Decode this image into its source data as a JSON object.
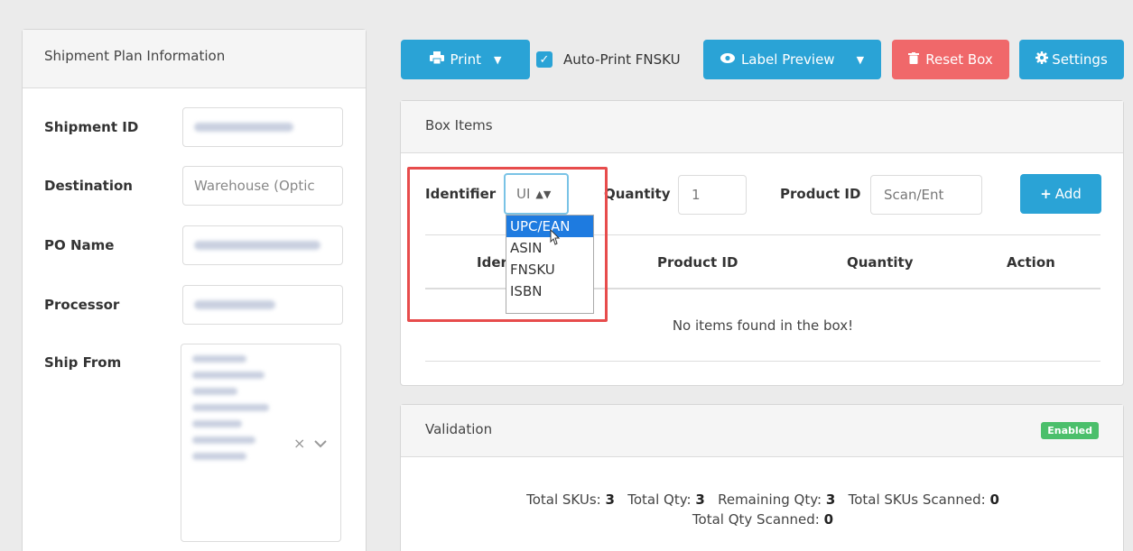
{
  "left_panel": {
    "title": "Shipment Plan Information",
    "fields": [
      {
        "label": "Shipment ID",
        "value": ""
      },
      {
        "label": "Destination",
        "value": "Warehouse (Optic"
      },
      {
        "label": "PO Name",
        "value": ""
      },
      {
        "label": "Processor",
        "value": ""
      },
      {
        "label": "Ship From",
        "value": ""
      }
    ],
    "clear_glyph": "×",
    "chevron_glyph": "⌄"
  },
  "toolbar": {
    "print_label": "Print",
    "auto_print_label": "Auto-Print FNSKU",
    "label_preview_label": "Label Preview",
    "reset_box_label": "Reset Box",
    "settings_label": "Settings"
  },
  "box_items": {
    "title": "Box Items",
    "identifier_label": "Identifier",
    "identifier_selected": "UI",
    "identifier_options": [
      "UPC/EAN",
      "ASIN",
      "FNSKU",
      "ISBN"
    ],
    "quantity_label": "Quantity",
    "quantity_value": "1",
    "product_id_label": "Product ID",
    "product_id_placeholder": "Scan/Ent",
    "add_label": "Add",
    "columns": [
      "Ider",
      "Product ID",
      "Quantity",
      "Action"
    ],
    "empty_message": "No items found in the box!"
  },
  "validation": {
    "title": "Validation",
    "badge": "Enabled",
    "total_skus_label": "Total SKUs:",
    "total_skus": "3",
    "total_qty_label": "Total Qty:",
    "total_qty": "3",
    "remaining_qty_label": "Remaining Qty:",
    "remaining_qty": "3",
    "total_skus_scanned_label": "Total SKUs Scanned:",
    "total_skus_scanned": "0",
    "total_qty_scanned_label": "Total Qty Scanned:",
    "total_qty_scanned": "0"
  },
  "colors": {
    "primary": "#2aa3d6",
    "danger": "#f0686a",
    "success": "#4bbf6b",
    "highlight": "#e74c4c",
    "selected_option": "#1e7be0"
  }
}
